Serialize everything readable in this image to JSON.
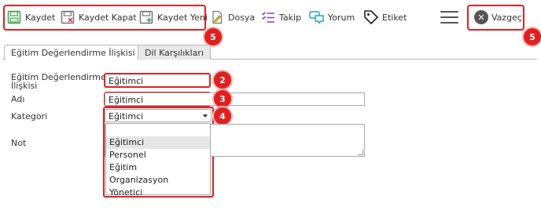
{
  "toolbar": {
    "save": "Kaydet",
    "save_close": "Kaydet Kapat",
    "save_new": "Kaydet Yeni",
    "file": "Dosya",
    "follow": "Takip",
    "comment": "Yorum",
    "tag": "Etiket",
    "cancel": "Vazgeç"
  },
  "tabs": {
    "active": "Eğitim Değerlendirme İlişkisi",
    "second": "Dil Karşılıkları"
  },
  "form": {
    "relation_label_line1": "Eğitim Değerlendirme",
    "relation_label_line2": "İlişkisi",
    "relation_value": "Eğitimci",
    "name_label": "Adı",
    "name_value": "Eğitimci",
    "category_label": "Kategori",
    "category_value": "Eğitimci",
    "note_label": "Not"
  },
  "dropdown": {
    "blank": "",
    "options": [
      "Eğitimci",
      "Personel",
      "Eğitim",
      "Organizasyon",
      "Yönetici"
    ]
  },
  "badges": {
    "toolbar_save": "5",
    "toolbar_cancel": "5",
    "relation": "2",
    "name": "3",
    "category": "4"
  },
  "colors": {
    "highlight": "#e02020",
    "save_icon": "#3aa34a",
    "follow_icon": "#7b3fc4",
    "comment_icon": "#1ea0c8"
  }
}
